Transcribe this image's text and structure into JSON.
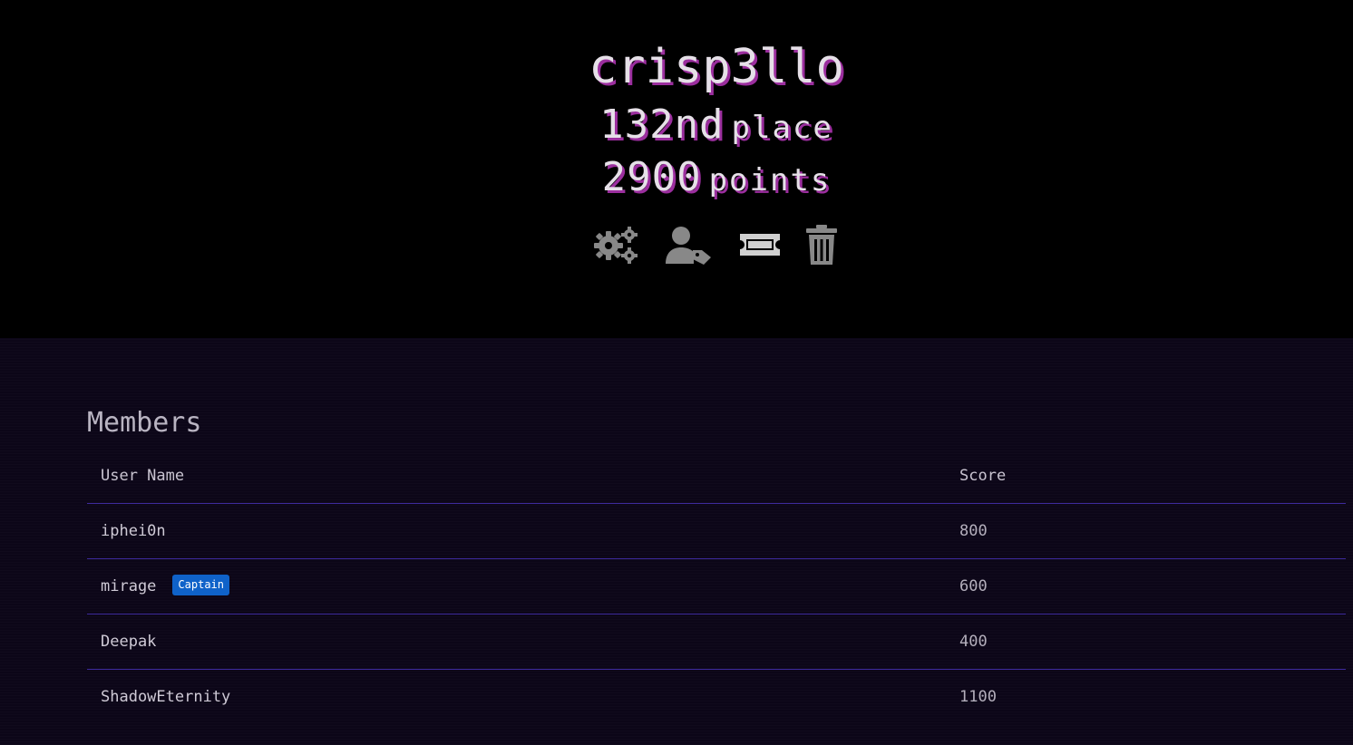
{
  "team": {
    "name": "crisp3llo",
    "place_value": "132nd",
    "place_label": "place",
    "points_value": "2900",
    "points_label": "points"
  },
  "actions": [
    {
      "icon": "settings-gears-icon",
      "color": "#888888"
    },
    {
      "icon": "user-tag-icon",
      "color": "#888888"
    },
    {
      "icon": "ticket-icon",
      "color": "#d0d0d0"
    },
    {
      "icon": "trash-icon",
      "color": "#888888"
    }
  ],
  "members": {
    "title": "Members",
    "columns": [
      "User Name",
      "Score"
    ],
    "rows": [
      {
        "user": "iphei0n",
        "score": "800",
        "badge": ""
      },
      {
        "user": "mirage",
        "score": "600",
        "badge": "Captain"
      },
      {
        "user": "Deepak",
        "score": "400",
        "badge": ""
      },
      {
        "user": "ShadowEternity",
        "score": "1100",
        "badge": ""
      }
    ]
  },
  "colors": {
    "hero_bg": "#000000",
    "section_bg": "#0c0618",
    "title_text": "#e6e0e8",
    "title_shadow": "#9b2e9e",
    "divider": "#3d2a9c",
    "badge_bg": "#0f62c9"
  }
}
